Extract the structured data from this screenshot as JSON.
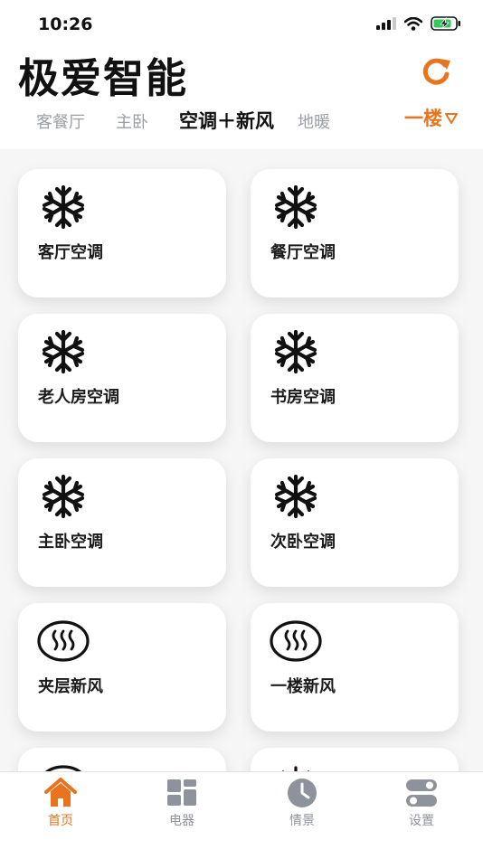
{
  "status_bar": {
    "time": "10:26"
  },
  "app": {
    "title": "极爱智能"
  },
  "tabs": [
    {
      "label": "客餐厅",
      "active": false
    },
    {
      "label": "主卧",
      "active": false
    },
    {
      "label": "空调＋新风",
      "active": true
    },
    {
      "label": "地暖",
      "active": false
    }
  ],
  "floor_selector": {
    "label": "一楼"
  },
  "devices": [
    {
      "name": "客厅空调",
      "icon": "snowflake-icon"
    },
    {
      "name": "餐厅空调",
      "icon": "snowflake-icon"
    },
    {
      "name": "老人房空调",
      "icon": "snowflake-icon"
    },
    {
      "name": "书房空调",
      "icon": "snowflake-icon"
    },
    {
      "name": "主卧空调",
      "icon": "snowflake-icon"
    },
    {
      "name": "次卧空调",
      "icon": "snowflake-icon"
    },
    {
      "name": "夹层新风",
      "icon": "fresh-air-icon"
    },
    {
      "name": "一楼新风",
      "icon": "fresh-air-icon"
    }
  ],
  "bottom_nav": [
    {
      "label": "首页",
      "icon": "home-icon",
      "active": true
    },
    {
      "label": "电器",
      "icon": "appliances-icon",
      "active": false
    },
    {
      "label": "情景",
      "icon": "clock-icon",
      "active": false
    },
    {
      "label": "设置",
      "icon": "settings-toggle-icon",
      "active": false
    }
  ],
  "colors": {
    "accent": "#e8741e",
    "inactive": "#8e939b",
    "background": "#f6f6f7"
  }
}
